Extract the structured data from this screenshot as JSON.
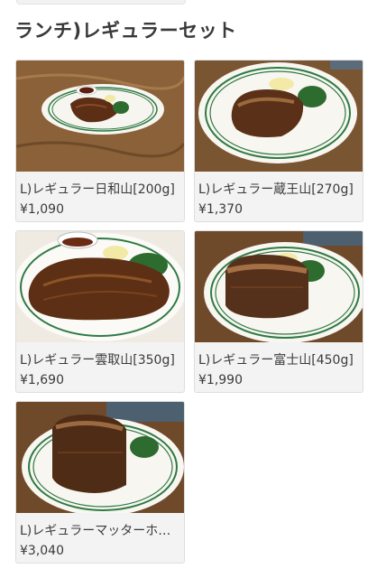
{
  "section": {
    "title": "ランチ)レギュラーセット"
  },
  "items": [
    {
      "name": "L)レギュラー日和山[200g]",
      "price": "¥1,090",
      "image": "steak-small-plate-photo"
    },
    {
      "name": "L)レギュラー蔵王山[270g]",
      "price": "¥1,370",
      "image": "steak-plate-photo"
    },
    {
      "name": "L)レギュラー雲取山[350g]",
      "price": "¥1,690",
      "image": "steak-large-plate-photo"
    },
    {
      "name": "L)レギュラー富士山[450g]",
      "price": "¥1,990",
      "image": "steak-thick-plate-photo"
    },
    {
      "name": "L)レギュラーマッターホ…",
      "price": "¥3,040",
      "image": "steak-tall-plate-photo"
    }
  ]
}
